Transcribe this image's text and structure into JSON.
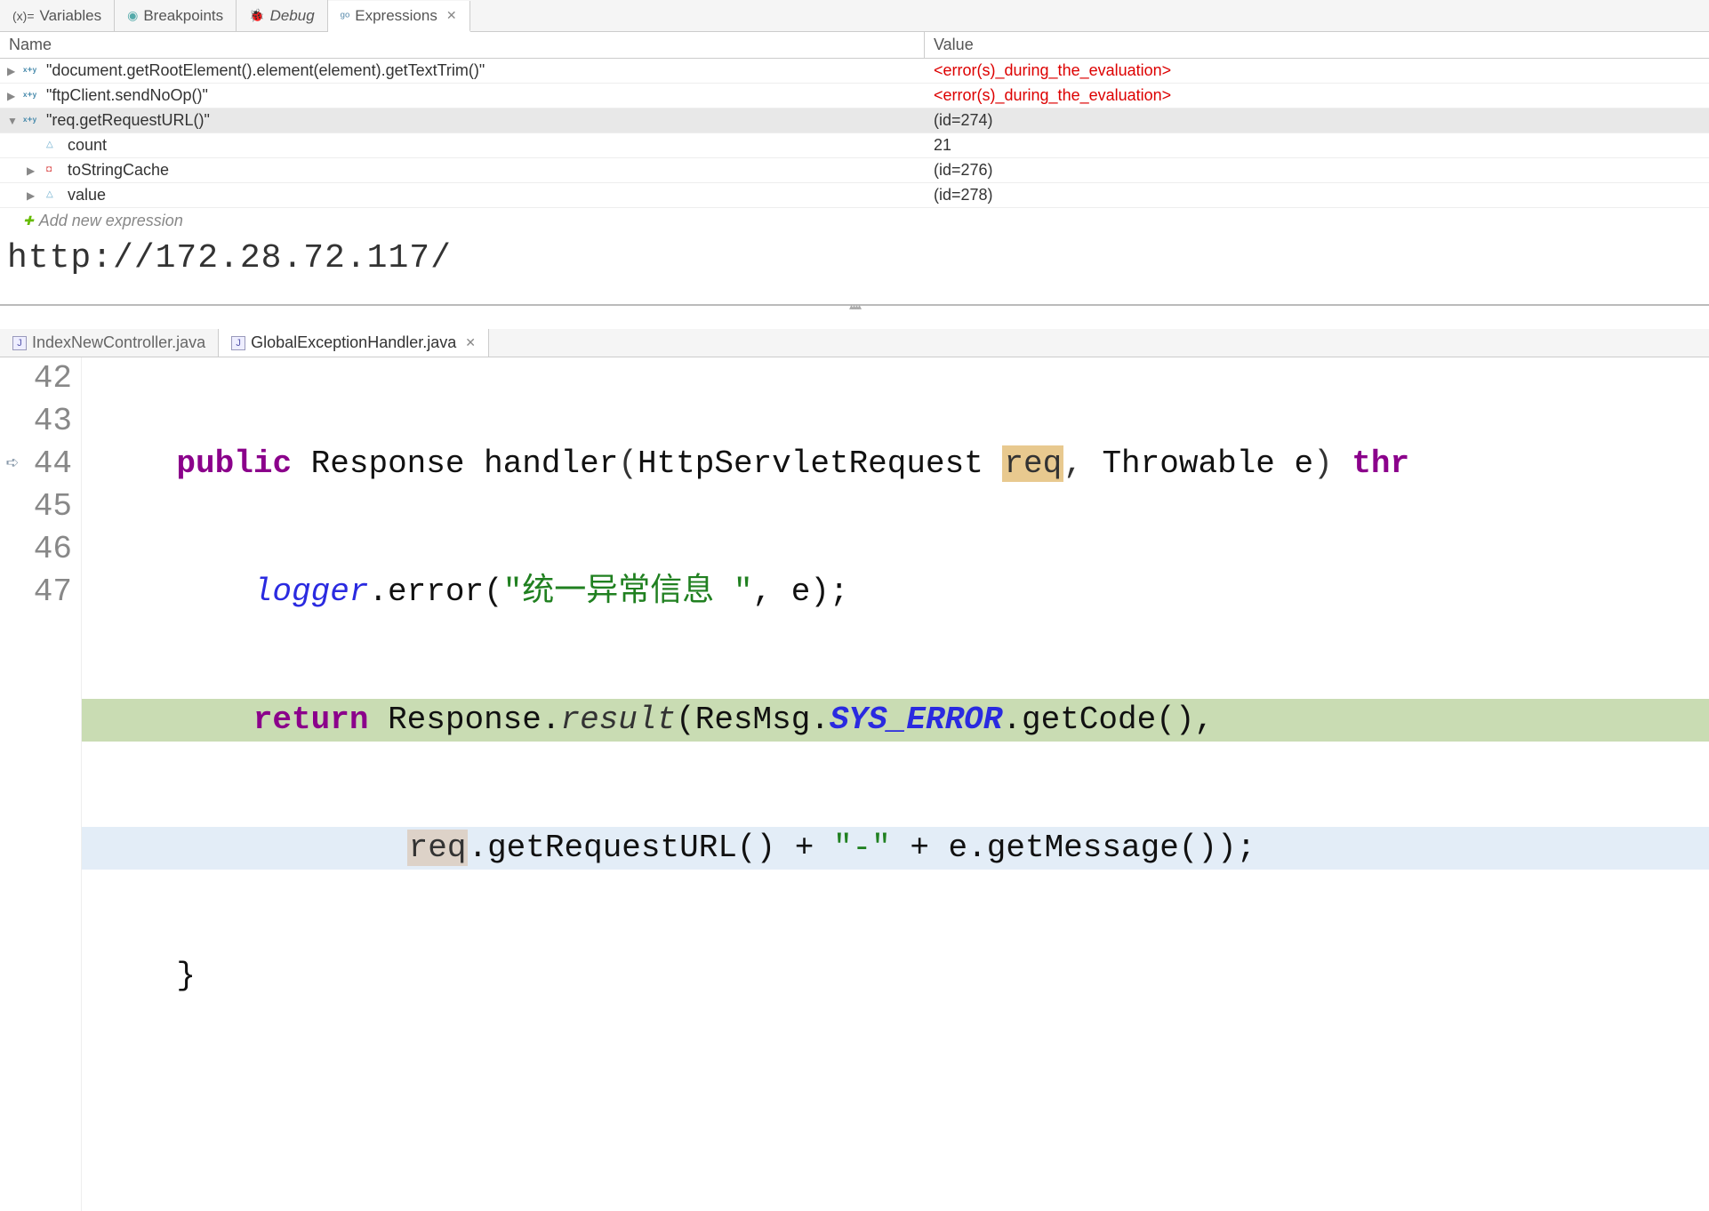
{
  "topTabs": {
    "variables": "Variables",
    "breakpoints": "Breakpoints",
    "debug": "Debug",
    "expressions": "Expressions"
  },
  "tableHeaders": {
    "name": "Name",
    "value": "Value"
  },
  "expressions": [
    {
      "name": "\"document.getRootElement().element(element).getTextTrim()\"",
      "value": "<error(s)_during_the_evaluation>",
      "error": true,
      "expanded": false
    },
    {
      "name": "\"ftpClient.sendNoOp()\"",
      "value": "<error(s)_during_the_evaluation>",
      "error": true,
      "expanded": false
    },
    {
      "name": "\"req.getRequestURL()\"",
      "value": "(id=274)",
      "error": false,
      "expanded": true
    }
  ],
  "children": [
    {
      "name": "count",
      "value": "21",
      "icon": "tri-open",
      "arrow": ""
    },
    {
      "name": "toStringCache",
      "value": "(id=276)",
      "icon": "tri-red",
      "arrow": "▶"
    },
    {
      "name": "value",
      "value": "(id=278)",
      "icon": "tri-open",
      "arrow": "▶"
    }
  ],
  "addExpression": "Add new expression",
  "detailValue": "http://172.28.72.117/",
  "editorTabs": {
    "inactive": "IndexNewController.java",
    "active": "GlobalExceptionHandler.java"
  },
  "lineNumbers": [
    "42",
    "43",
    "44",
    "45",
    "46",
    "47"
  ],
  "code": {
    "l42": {
      "kw": "public",
      "ret": "Response",
      "method": "handler",
      "p1type": "HttpServletRequest",
      "p1name": "req",
      "p2type": "Throwable",
      "p2name": "e",
      "tail": "thr"
    },
    "l43": {
      "logger": "logger",
      "call": ".error(",
      "str": "\"统一异常信息 \"",
      "rest": ", e);"
    },
    "l44": {
      "kw": "return",
      "resp": "Response.",
      "result": "result",
      "open": "(ResMsg.",
      "sys": "SYS_ERROR",
      "rest": ".getCode(),"
    },
    "l45": {
      "req": "req",
      "mid": ".getRequestURL() + ",
      "dash": "\"-\"",
      "rest": " + e.getMessage());"
    },
    "l46": {
      "brace": "}"
    },
    "l47": {
      "empty": ""
    }
  }
}
